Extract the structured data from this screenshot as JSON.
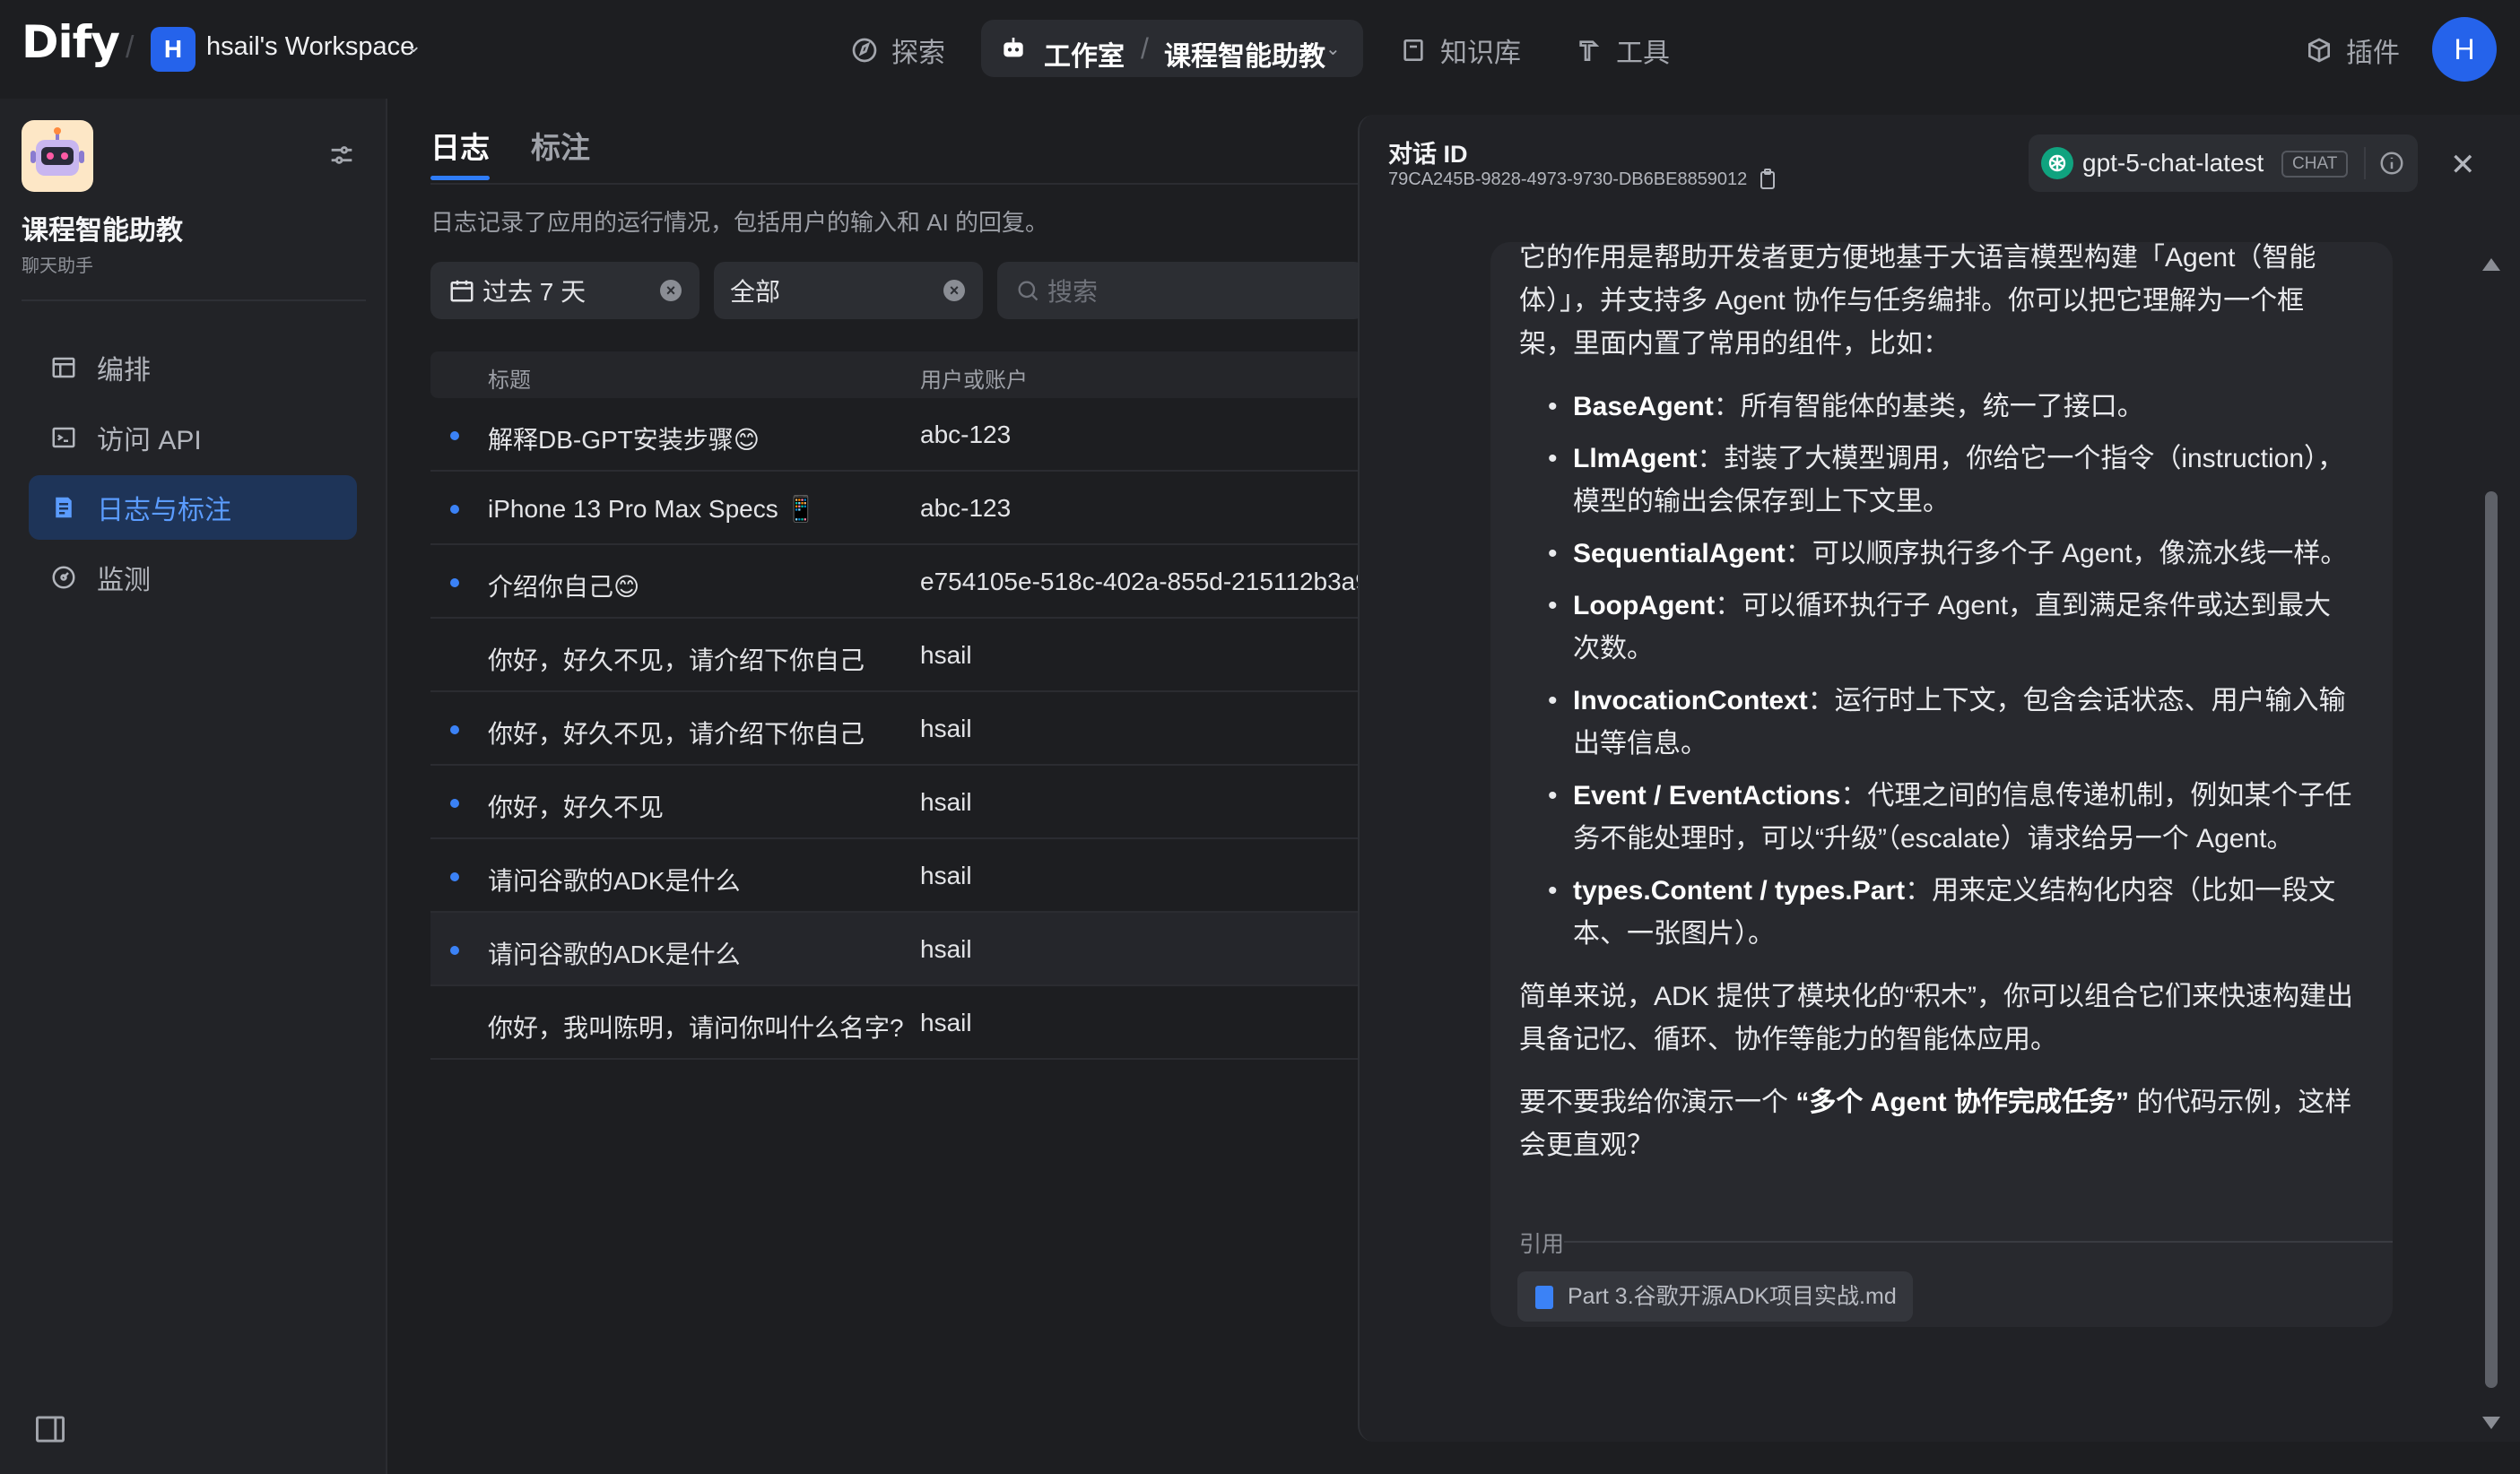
{
  "header": {
    "logo": "Dify",
    "separator": "/",
    "workspace_initial": "H",
    "workspace_name": "hsail's Workspace",
    "nav": {
      "explore": "探索",
      "studio": "工作室",
      "app_name": "课程智能助教",
      "knowledge": "知识库",
      "tools": "工具",
      "plugins": "插件"
    },
    "user_initial": "H",
    "accent_color": "#2563eb"
  },
  "sidebar": {
    "app_name": "课程智能助教",
    "app_type": "聊天助手",
    "items": [
      {
        "label": "编排",
        "icon": "layout-icon"
      },
      {
        "label": "访问 API",
        "icon": "terminal-icon"
      },
      {
        "label": "日志与标注",
        "icon": "doc-icon",
        "active": true
      },
      {
        "label": "监测",
        "icon": "monitor-icon"
      }
    ]
  },
  "main": {
    "tabs": [
      "日志",
      "标注"
    ],
    "description": "日志记录了应用的运行情况，包括用户的输入和 AI 的回复。",
    "filters": {
      "period": "过去 7 天",
      "status": "全部",
      "search_placeholder": "搜索"
    },
    "columns": {
      "title": "标题",
      "user": "用户或账户"
    },
    "rows": [
      {
        "title": "解释DB-GPT安装步骤😊",
        "user": "abc-123",
        "dot": true
      },
      {
        "title": "iPhone 13 Pro Max Specs 📱",
        "user": "abc-123",
        "dot": true
      },
      {
        "title": "介绍你自己😊",
        "user": "e754105e-518c-402a-855d-215112b3a9",
        "dot": true
      },
      {
        "title": "你好，好久不见，请介绍下你自己",
        "user": "hsail",
        "dot": false
      },
      {
        "title": "你好，好久不见，请介绍下你自己",
        "user": "hsail",
        "dot": true
      },
      {
        "title": "你好，好久不见",
        "user": "hsail",
        "dot": true
      },
      {
        "title": "请问谷歌的ADK是什么",
        "user": "hsail",
        "dot": true
      },
      {
        "title": "请问谷歌的ADK是什么",
        "user": "hsail",
        "dot": true
      },
      {
        "title": "你好，我叫陈明，请问你叫什么名字?",
        "user": "hsail",
        "dot": false
      }
    ]
  },
  "drawer": {
    "conversation_label": "对话 ID",
    "conversation_id": "79CA245B-9828-4973-9730-DB6BE8859012",
    "model_name": "gpt-5-chat-latest",
    "model_mode": "CHAT",
    "message": {
      "intro": "它的作用是帮助开发者更方便地基于大语言模型构建「Agent（智能体）」，并支持多 Agent 协作与任务编排。你可以把它理解为一个框架，里面内置了常用的组件，比如：",
      "bullets": [
        {
          "term": "BaseAgent",
          "text": "：所有智能体的基类，统一了接口。"
        },
        {
          "term": "LlmAgent",
          "text": "：封装了大模型调用，你给它一个指令（instruction），模型的输出会保存到上下文里。"
        },
        {
          "term": "SequentialAgent",
          "text": "：可以顺序执行多个子 Agent，像流水线一样。"
        },
        {
          "term": "LoopAgent",
          "text": "：可以循环执行子 Agent，直到满足条件或达到最大次数。"
        },
        {
          "term": "InvocationContext",
          "text": "：运行时上下文，包含会话状态、用户输入输出等信息。"
        },
        {
          "term": "Event / EventActions",
          "text": "：代理之间的信息传递机制，例如某个子任务不能处理时，可以“升级”（escalate）请求给另一个 Agent。"
        },
        {
          "term": "types.Content / types.Part",
          "text": "：用来定义结构化内容（比如一段文本、一张图片）。"
        }
      ],
      "summary": "简单来说，ADK 提供了模块化的“积木”，你可以组合它们来快速构建出具备记忆、循环、协作等能力的智能体应用。",
      "question_pre": "要不要我给你演示一个 ",
      "question_bold": "“多个 Agent 协作完成任务”",
      "question_post": " 的代码示例，这样会更直观？"
    },
    "citation_label": "引用",
    "citation_file": "Part 3.谷歌开源ADK项目实战.md"
  }
}
